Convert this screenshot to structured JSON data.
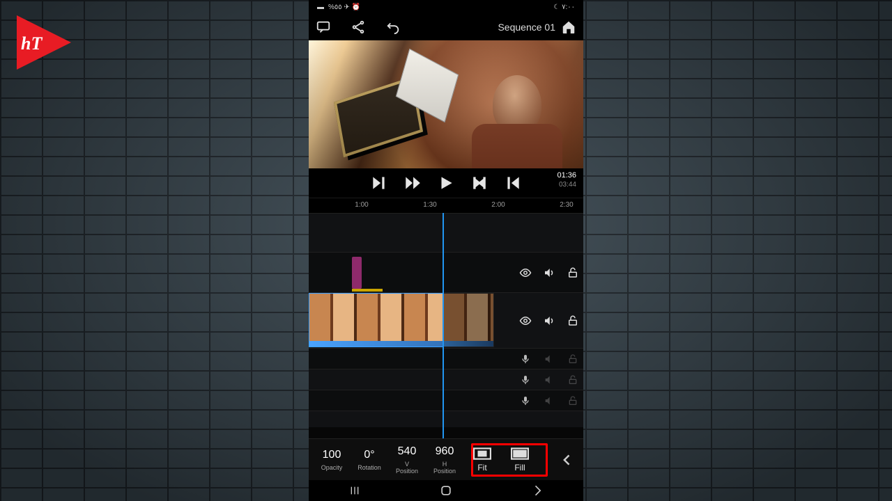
{
  "status_bar": {
    "left_text": "%٥٥ ✈ ⏰",
    "battery_icon": "battery",
    "right_text": "☾ ٧:٠٠"
  },
  "appbar": {
    "comment_icon": "comment",
    "share_icon": "share",
    "undo_icon": "undo",
    "sequence_name": "Sequence 01",
    "home_icon": "home"
  },
  "timecode": {
    "current": "01:36",
    "duration": "03:44"
  },
  "transport": {
    "skip_fwd": "skip-forward",
    "play_fast": "play-speed",
    "play": "play",
    "step_back": "step-back",
    "skip_back": "skip-back"
  },
  "ruler": [
    "1:00",
    "1:30",
    "2:00",
    "2:30"
  ],
  "tracks": {
    "track_controls": {
      "eye": "visibility",
      "speaker": "volume",
      "lock": "unlock",
      "mic": "microphone"
    }
  },
  "properties": {
    "opacity": {
      "value": "100",
      "label": "Opacity"
    },
    "rotation": {
      "value": "0°",
      "label": "Rotation"
    },
    "vpos": {
      "value": "540",
      "label": "V\nPosition"
    },
    "hpos": {
      "value": "960",
      "label": "H\nPosition"
    },
    "fit": {
      "label": "Fit"
    },
    "fill": {
      "label": "Fill"
    }
  },
  "nav": {
    "recent": "recent-apps",
    "home": "home",
    "back": "back"
  },
  "logo": "hT"
}
